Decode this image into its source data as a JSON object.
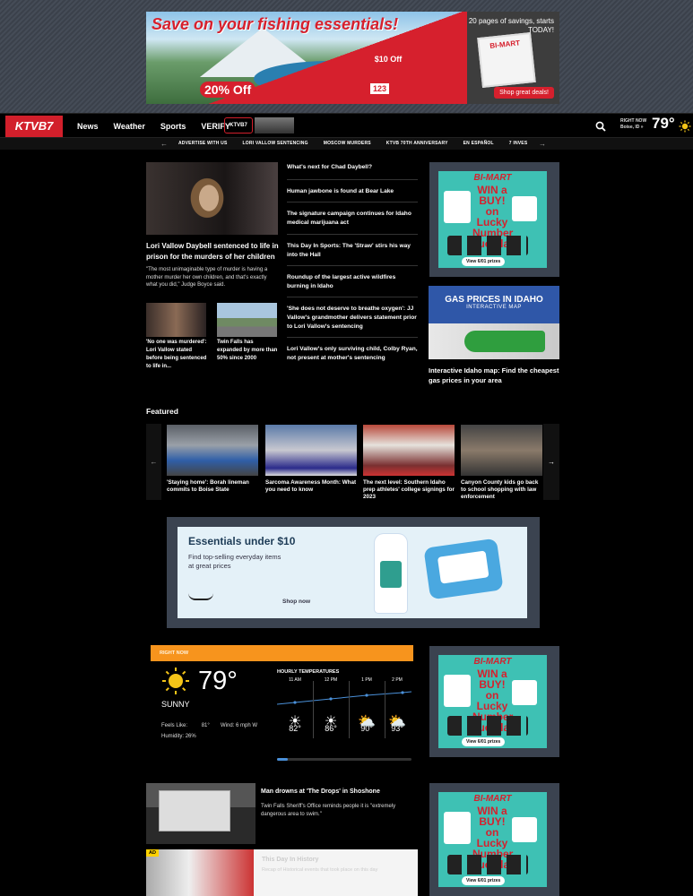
{
  "top_ad": {
    "headline": "Save on your fishing essentials!",
    "discount": "20% Off",
    "offer": "$10 Off",
    "price": "123",
    "side_text": "20 pages of savings, starts TODAY!",
    "brand": "BI-MART",
    "cta": "Shop great deals!"
  },
  "nav": {
    "logo": "KTVB7",
    "items": [
      "News",
      "Weather",
      "Sports",
      "VERIFY"
    ],
    "live_logo": "KTVB7",
    "weather_label": "RIGHT NOW",
    "location": "Boise, ID »",
    "temp": "79°"
  },
  "subnav": {
    "items": [
      "ADVERTISE WITH US",
      "LORI VALLOW SENTENCING",
      "MOSCOW MURDERS",
      "KTVB 70TH ANNIVERSARY",
      "EN ESPAÑOL",
      "7 INVES"
    ]
  },
  "lead": {
    "title": "Lori Vallow Daybell sentenced to life in prison for the murders of her children",
    "summary": "\"The most unimaginable type of murder is having a mother murder her own children, and that's exactly what you did,\" Judge Boyce said."
  },
  "sub_stories": [
    {
      "caption": "'No one was murdered': Lori Vallow stated before being sentenced to life in..."
    },
    {
      "caption": "Twin Falls has expanded by more than 50% since 2000"
    }
  ],
  "headlines": [
    "What's next for Chad Daybell?",
    "Human jawbone is found at Bear Lake",
    "The signature campaign continues for Idaho medical marijuana act",
    "This Day In Sports: The 'Straw' stirs his way into the Hall",
    "Roundup of the largest active wildfires burning in Idaho",
    "'She does not deserve to breathe oxygen': JJ Vallow's grandmother delivers statement prior to Lori Vallow's sentencing",
    "Lori Vallow's only surviving child, Colby Ryan, not present at mother's sentencing"
  ],
  "bimart_ad": {
    "brand": "BI-MART",
    "headline": "WIN a BUY! on Lucky Number Tuesday!",
    "cta": "View 6/01 prizes"
  },
  "gas": {
    "title": "GAS PRICES IN IDAHO",
    "subtitle": "INTERACTIVE MAP",
    "caption": "Interactive Idaho map: Find the cheapest gas prices in your area"
  },
  "featured": {
    "heading": "Featured",
    "items": [
      {
        "caption": "'Staying home': Borah lineman commits to Boise State"
      },
      {
        "caption": "Sarcoma Awareness Month: What you need to know"
      },
      {
        "caption": "The next level: Southern Idaho prep athletes' college signings for 2023"
      },
      {
        "caption": "Canyon County kids go back to school shopping with law enforcement"
      }
    ]
  },
  "amazon_ad": {
    "headline": "Essentials under $10",
    "sub": "Find top-selling everyday items at great prices",
    "cta": "Shop now"
  },
  "weather": {
    "banner": "RIGHT NOW",
    "temp": "79°",
    "condition": "SUNNY",
    "feels_like_label": "Feels Like:",
    "feels_like": "81°",
    "wind_label": "Wind:",
    "wind": "6 mph W",
    "humidity_label": "Humidity:",
    "humidity": "26%",
    "hourly_heading": "HOURLY TEMPERATURES",
    "hours": [
      {
        "time": "11 AM",
        "temp": "82°",
        "icon": "sun-icon"
      },
      {
        "time": "12 PM",
        "temp": "86°",
        "icon": "sun-icon"
      },
      {
        "time": "1 PM",
        "temp": "90°",
        "icon": "partly-cloudy-icon"
      },
      {
        "time": "2 PM",
        "temp": "93°",
        "icon": "partly-cloudy-icon"
      }
    ]
  },
  "story": {
    "title": "Man drowns at 'The Drops' in Shoshone",
    "summary": "Twin Falls Sheriff's Office reminds people it is \"extremely dangerous area to swim.\""
  },
  "promo": {
    "badge": "AD",
    "title": "This Day In History",
    "sub": "Recap of Historical events that took place on this day"
  },
  "colors": {
    "brand_red": "#d21f2b",
    "accent_orange": "#f7941d",
    "ad_frame": "#3b4350"
  }
}
